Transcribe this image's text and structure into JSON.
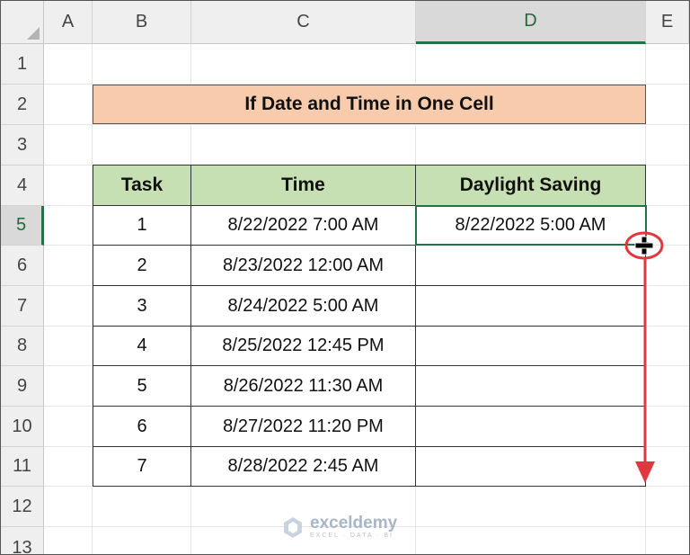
{
  "sheet": {
    "columns": [
      "A",
      "B",
      "C",
      "D",
      "E"
    ],
    "active_column": "D",
    "rows": [
      "1",
      "2",
      "3",
      "4",
      "5",
      "6",
      "7",
      "8",
      "9",
      "10",
      "11",
      "12",
      "13"
    ],
    "active_row": "5"
  },
  "title": "If Date and Time in One Cell",
  "table": {
    "headers": [
      "Task",
      "Time",
      "Daylight Saving"
    ],
    "rows": [
      {
        "task": "1",
        "time": "8/22/2022 7:00 AM",
        "daylight": "8/22/2022 5:00 AM"
      },
      {
        "task": "2",
        "time": "8/23/2022 12:00 AM",
        "daylight": ""
      },
      {
        "task": "3",
        "time": "8/24/2022 5:00 AM",
        "daylight": ""
      },
      {
        "task": "4",
        "time": "8/25/2022 12:45 PM",
        "daylight": ""
      },
      {
        "task": "5",
        "time": "8/26/2022 11:30 AM",
        "daylight": ""
      },
      {
        "task": "6",
        "time": "8/27/2022 11:20 PM",
        "daylight": ""
      },
      {
        "task": "7",
        "time": "8/28/2022 2:45 AM",
        "daylight": ""
      }
    ]
  },
  "selection": {
    "cell": "D5"
  },
  "annotation": {
    "cursor_icon": "fill-handle-crosshair-icon",
    "arrow_icon": "drag-down-arrow-icon",
    "color": "#e0383e"
  },
  "watermark": {
    "name": "exceldemy",
    "tagline": "EXCEL · DATA · BI"
  }
}
